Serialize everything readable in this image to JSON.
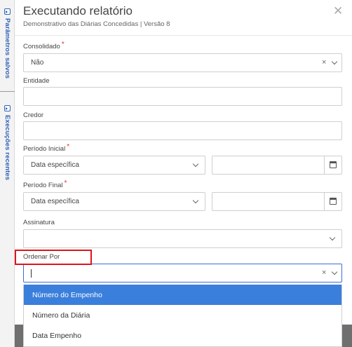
{
  "side_panel": {
    "saved_params": "Parâmetros salvos",
    "recent_runs": "Execuções recentes"
  },
  "modal": {
    "title": "Executando relatório",
    "subtitle": "Demonstrativo das Diárias Concedidas | Versão 8",
    "close_glyph": "✕"
  },
  "fields": {
    "consolidado": {
      "label": "Consolidado",
      "required": "*",
      "value": "Não"
    },
    "entidade": {
      "label": "Entidade",
      "value": ""
    },
    "credor": {
      "label": "Credor",
      "value": ""
    },
    "periodo_inicial": {
      "label": "Período Inicial",
      "required": "*",
      "value": "Data específica",
      "date": ""
    },
    "periodo_final": {
      "label": "Período Final",
      "required": "*",
      "value": "Data específica",
      "date": ""
    },
    "assinatura": {
      "label": "Assinatura",
      "value": ""
    },
    "ordenar_por": {
      "label": "Ordenar Por",
      "value": ""
    }
  },
  "dropdown": {
    "options": [
      "Número do Empenho",
      "Número da Diária",
      "Data Empenho"
    ],
    "selected_index": 0
  },
  "colors": {
    "accent": "#3b7fdc",
    "side_text": "#2f63b8",
    "required": "#d9342b",
    "highlight_box": "#e0131c"
  }
}
